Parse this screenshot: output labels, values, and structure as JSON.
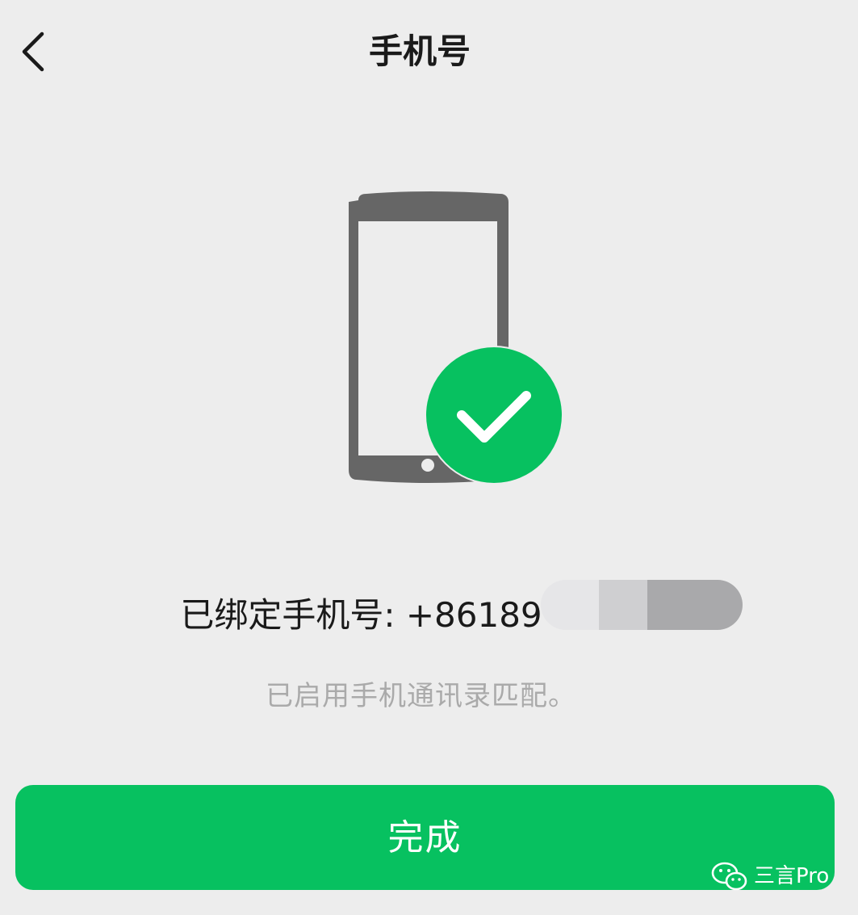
{
  "nav": {
    "back_icon": "chevron-left-icon",
    "title": "手机号"
  },
  "illustration": {
    "phone_icon": "smartphone-icon",
    "check_icon": "check-circle-icon",
    "colors": {
      "phone": "#666666",
      "check_badge": "#07c160"
    }
  },
  "binding": {
    "label": "已绑定手机号: +86189"
  },
  "hint": "已启用手机通讯录匹配。",
  "done_button": {
    "label": "完成",
    "color": "#07c160"
  },
  "watermark": {
    "icon": "wechat-logo-icon",
    "text": "三言Pro"
  }
}
